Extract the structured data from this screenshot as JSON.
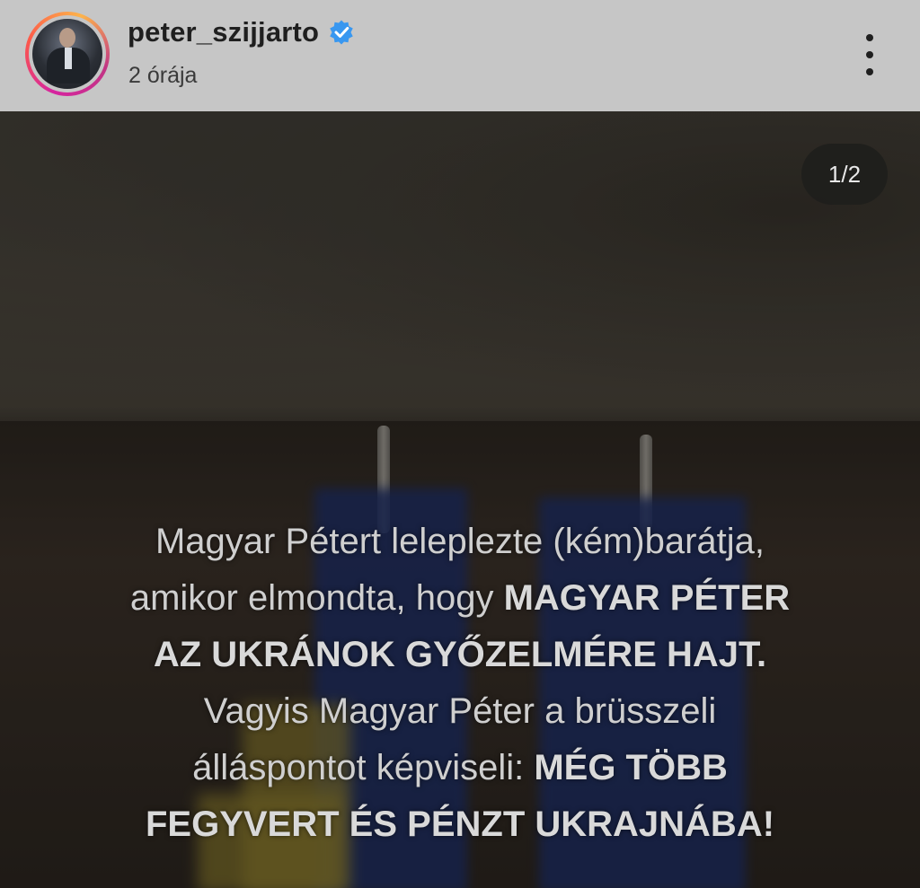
{
  "header": {
    "username": "peter_szijjarto",
    "timestamp": "2 órája",
    "verified": true,
    "accent_verified": "#3897f0"
  },
  "media": {
    "counter": "1/2",
    "caption": {
      "l1": "Magyar Pétert leleplezte (kém)barátja,",
      "l2a": "amikor elmondta, hogy ",
      "l2b": "MAGYAR PÉTER",
      "l3": "AZ UKRÁNOK GYŐZELMÉRE HAJT.",
      "l4": "Vagyis Magyar Péter a brüsszeli",
      "l5a": "álláspontot képviseli: ",
      "l5b": "MÉG TÖBB",
      "l6": "FEGYVERT ÉS PÉNZT UKRAJNÁBA!"
    }
  }
}
